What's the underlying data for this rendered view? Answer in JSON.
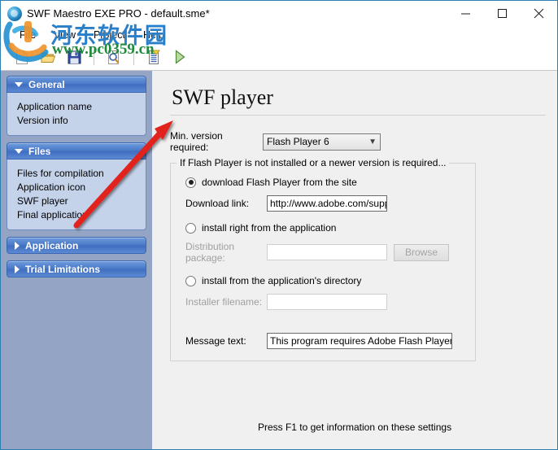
{
  "window": {
    "title": "SWF Maestro EXE PRO - default.sme*",
    "app_icon": "swf-maestro-icon",
    "controls": {
      "minimize": "minimize-icon",
      "maximize": "maximize-icon",
      "close": "close-icon"
    }
  },
  "menu": {
    "items": [
      {
        "label": "File"
      },
      {
        "label": "View"
      },
      {
        "label": "Project"
      },
      {
        "label": "Help"
      }
    ]
  },
  "toolbar": {
    "buttons": [
      {
        "name": "new-file-icon",
        "tooltip": "New"
      },
      {
        "name": "open-folder-icon",
        "tooltip": "Open"
      },
      {
        "name": "save-floppy-icon",
        "tooltip": "Save"
      },
      {
        "name": "preview-magnifier-icon",
        "tooltip": "Preview"
      },
      {
        "name": "compile-list-icon",
        "tooltip": "Compile"
      },
      {
        "name": "run-play-icon",
        "tooltip": "Run"
      }
    ]
  },
  "sidebar": {
    "panels": [
      {
        "title": "General",
        "expanded": true,
        "items": [
          {
            "label": "Application name"
          },
          {
            "label": "Version info"
          }
        ]
      },
      {
        "title": "Files",
        "expanded": true,
        "items": [
          {
            "label": "Files for compilation"
          },
          {
            "label": "Application icon"
          },
          {
            "label": "SWF player"
          },
          {
            "label": "Final application"
          }
        ]
      },
      {
        "title": "Application",
        "expanded": false,
        "items": []
      },
      {
        "title": "Trial Limitations",
        "expanded": false,
        "items": []
      }
    ]
  },
  "content": {
    "page_title": "SWF player",
    "min_version": {
      "label": "Min. version required:",
      "value": "Flash Player 6",
      "chevron": "chevron-down-icon"
    },
    "group": {
      "title": "If Flash Player is not installed or a newer version is required...",
      "option_download": {
        "label": "download Flash Player from the site",
        "selected": true
      },
      "download_link": {
        "label": "Download link:",
        "value": "http://www.adobe.com/supp"
      },
      "option_install_from_app": {
        "label": "install right from the application",
        "selected": false
      },
      "distribution_package": {
        "label": "Distribution package:",
        "value": "",
        "browse_label": "Browse"
      },
      "option_install_from_dir": {
        "label": "install from the application's directory",
        "selected": false
      },
      "installer_filename": {
        "label": "Installer filename:",
        "value": ""
      },
      "message_text": {
        "label": "Message text:",
        "value": "This program requires Adobe Flash Player Activ"
      }
    },
    "footer": "Press F1 to get information on these settings"
  },
  "watermark": {
    "chinese": "河东软件园",
    "url": "www.pc0359.cn",
    "logo": "watermark-logo"
  },
  "colors": {
    "window_border": "#2e7fb0",
    "sidebar_bg": "#94a4c4",
    "panel_header_blue": "#4a79c8",
    "panel_body_blue": "#c4d2ea",
    "content_bg": "#f0f0f0",
    "watermark_blue": "#2a7fc9",
    "watermark_green": "#1f8a3b",
    "annotation_red": "#e2231a"
  }
}
